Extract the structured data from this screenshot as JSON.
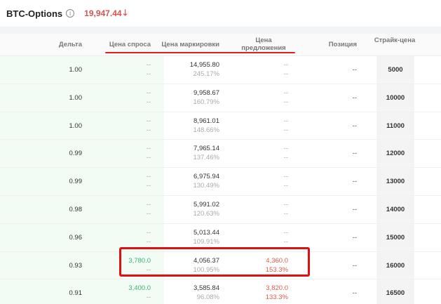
{
  "header": {
    "title": "BTC-Options",
    "info_icon": "info-icon",
    "price": "19,947.44",
    "price_color": "#d9534f"
  },
  "columns": {
    "delta": "Дельта",
    "bid": "Цена спроса",
    "mark": "Цена маркировки",
    "ask": "Цена предложения",
    "position": "Позиция",
    "strike": "Страйк-цена"
  },
  "rows": [
    {
      "delta": "1.00",
      "bid": "--",
      "bid_iv": "--",
      "mark": "14,955.80",
      "mark_iv": "245.17%",
      "ask": "--",
      "ask_iv": "--",
      "position": "--",
      "strike": "5000"
    },
    {
      "delta": "1.00",
      "bid": "--",
      "bid_iv": "--",
      "mark": "9,958.67",
      "mark_iv": "160.79%",
      "ask": "--",
      "ask_iv": "--",
      "position": "--",
      "strike": "10000"
    },
    {
      "delta": "1.00",
      "bid": "--",
      "bid_iv": "--",
      "mark": "8,961.01",
      "mark_iv": "148.66%",
      "ask": "--",
      "ask_iv": "--",
      "position": "--",
      "strike": "11000"
    },
    {
      "delta": "0.99",
      "bid": "--",
      "bid_iv": "--",
      "mark": "7,965.14",
      "mark_iv": "137.46%",
      "ask": "--",
      "ask_iv": "--",
      "position": "--",
      "strike": "12000"
    },
    {
      "delta": "0.99",
      "bid": "--",
      "bid_iv": "--",
      "mark": "6,975.94",
      "mark_iv": "130.49%",
      "ask": "--",
      "ask_iv": "--",
      "position": "--",
      "strike": "13000"
    },
    {
      "delta": "0.98",
      "bid": "--",
      "bid_iv": "--",
      "mark": "5,991.02",
      "mark_iv": "120.63%",
      "ask": "--",
      "ask_iv": "--",
      "position": "--",
      "strike": "14000"
    },
    {
      "delta": "0.96",
      "bid": "--",
      "bid_iv": "--",
      "mark": "5,013.44",
      "mark_iv": "109.91%",
      "ask": "--",
      "ask_iv": "--",
      "position": "--",
      "strike": "15000"
    },
    {
      "delta": "0.93",
      "bid": "3,780.0",
      "bid_iv": "--",
      "mark": "4,056.37",
      "mark_iv": "100.95%",
      "ask": "4,360.0",
      "ask_iv": "153.3%",
      "position": "--",
      "strike": "16000"
    },
    {
      "delta": "0.91",
      "bid": "3,400.0",
      "bid_iv": "--",
      "mark": "3,585.84",
      "mark_iv": "96.08%",
      "ask": "3,820.0",
      "ask_iv": "133.3%",
      "position": "--",
      "strike": "16500"
    }
  ],
  "colors": {
    "bid_active": "#3cb371",
    "ask_active": "#e05a50",
    "highlight": "#e01010"
  }
}
